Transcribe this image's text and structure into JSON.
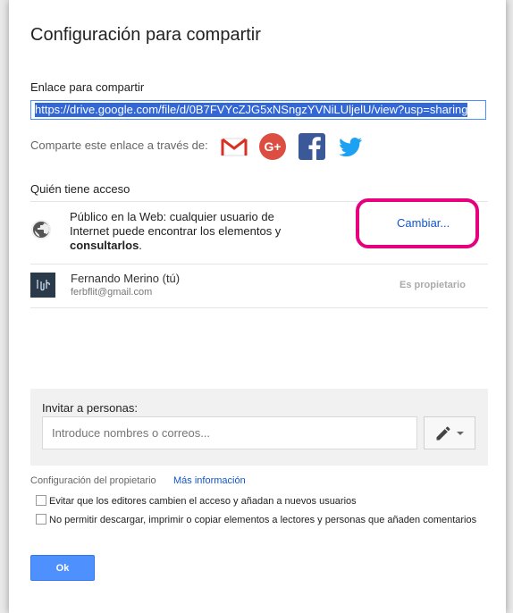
{
  "dialog": {
    "title": "Configuración para compartir"
  },
  "share_link": {
    "label": "Enlace para compartir",
    "url": "https://drive.google.com/file/d/0B7FVYcZJG5xNSngzYVNiLUljelU/view?usp=sharing"
  },
  "share_via": {
    "label": "Comparte este enlace a través de:",
    "icons": [
      "gmail-icon",
      "google-plus-icon",
      "facebook-icon",
      "twitter-icon"
    ]
  },
  "access": {
    "label": "Quién tiene acceso",
    "public_line1": "Público en la Web: cualquier usuario de Internet puede encontrar los elementos y ",
    "public_bold": "consultarlos",
    "public_end": ".",
    "change_label": "Cambiar...",
    "owner_name": "Fernando Merino (tú)",
    "owner_email": "ferbflit@gmail.com",
    "owner_role": "Es propietario"
  },
  "invite": {
    "label": "Invitar a personas:",
    "placeholder": "Introduce nombres o correos..."
  },
  "owner_settings": {
    "label": "Configuración del propietario",
    "more_info": "Más información",
    "option1": "Evitar que los editores cambien el acceso y añadan a nuevos usuarios",
    "option2": "No permitir descargar, imprimir o copiar elementos a lectores y personas que añaden comentarios"
  },
  "ok_label": "Ok",
  "colors": {
    "accent": "#4d90fe",
    "link": "#1155cc",
    "highlight": "#e6007e"
  }
}
